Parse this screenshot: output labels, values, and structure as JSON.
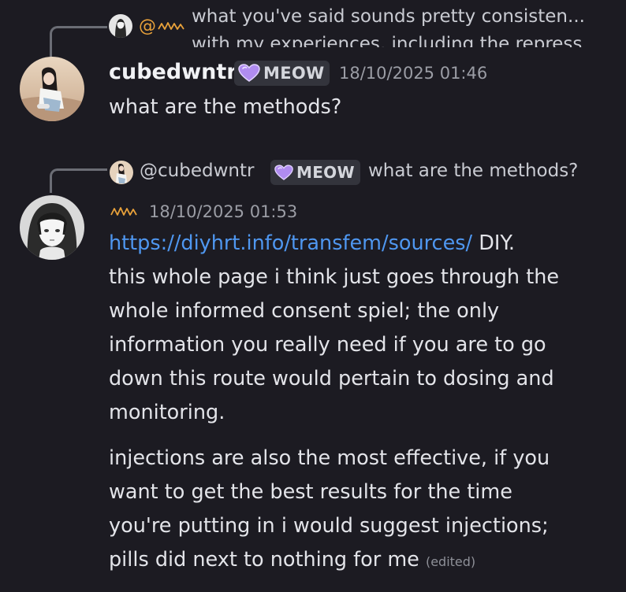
{
  "colors": {
    "background": "#1c1b22",
    "link": "#4f97f0",
    "tag_bg": "#33343c",
    "heart": "#b08cf0",
    "squiggle_orange": "#e8a13a"
  },
  "message1": {
    "reply": {
      "author_icon": "squiggle-orange-icon",
      "author_prefix": "@",
      "text_line1": "what you've said sounds pretty consisten...",
      "text_line2": "with my experiences, including the repress"
    },
    "author": "cubedwntr",
    "tag": {
      "icon": "purple-heart-icon",
      "label": "MEOW"
    },
    "timestamp": "18/10/2025 01:46",
    "content": "what are the methods?"
  },
  "message2": {
    "reply": {
      "author": "@cubedwntr",
      "tag": {
        "icon": "purple-heart-icon",
        "label": "MEOW"
      },
      "text": "what are the methods?"
    },
    "author_icon": "squiggle-orange-icon",
    "timestamp": "18/10/2025 01:53",
    "paragraph1": {
      "link": "https://diyhrt.info/transfem/sources/",
      "lines": [
        " DIY.",
        "this whole page i think just goes through the",
        "whole informed consent spiel; the only",
        "information you really need if you are to go",
        "down this route would pertain to dosing and",
        "monitoring."
      ]
    },
    "paragraph2": {
      "lines": [
        "injections are also the most effective, if you",
        "want to get the best results for the time",
        "you're putting in i would suggest injections;",
        "pills did next to nothing for me"
      ],
      "edited": "(edited)"
    }
  }
}
